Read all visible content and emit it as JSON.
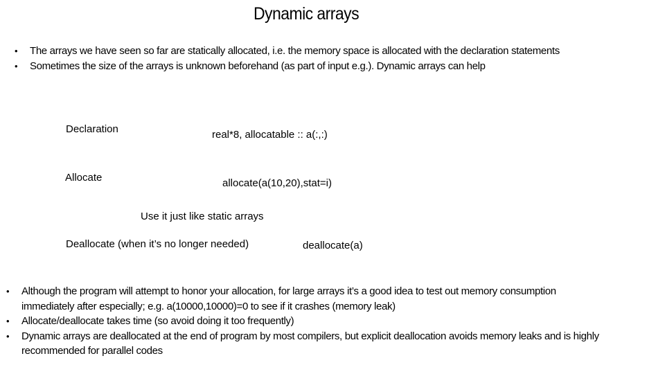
{
  "slide": {
    "title": "Dynamic arrays",
    "intro_bullets": [
      "The arrays we have seen so far are statically allocated, i.e. the memory space is allocated with the declaration statements",
      "Sometimes the size of the arrays is unknown beforehand (as part of input e.g.). Dynamic arrays can help"
    ],
    "steps": {
      "declaration_label": "Declaration",
      "declaration_code": "real*8, allocatable :: a(:,:)",
      "allocate_label": "Allocate",
      "allocate_code": "allocate(a(10,20),stat=i)",
      "use_note": "Use it just like static arrays",
      "deallocate_label": "Deallocate (when it’s no longer needed)",
      "deallocate_code": "deallocate(a)"
    },
    "notes_bullets": [
      "Although the program will attempt to honor your allocation, for large arrays it’s a good idea to test out memory consumption immediately after especially; e.g. a(10000,10000)=0 to see if it crashes (memory leak)",
      "Allocate/deallocate takes time (so avoid doing it too frequently)",
      "Dynamic arrays are deallocated at the end of program by most compilers, but explicit deallocation avoids memory leaks and is highly recommended for parallel codes"
    ],
    "bullet_glyph": "•"
  }
}
